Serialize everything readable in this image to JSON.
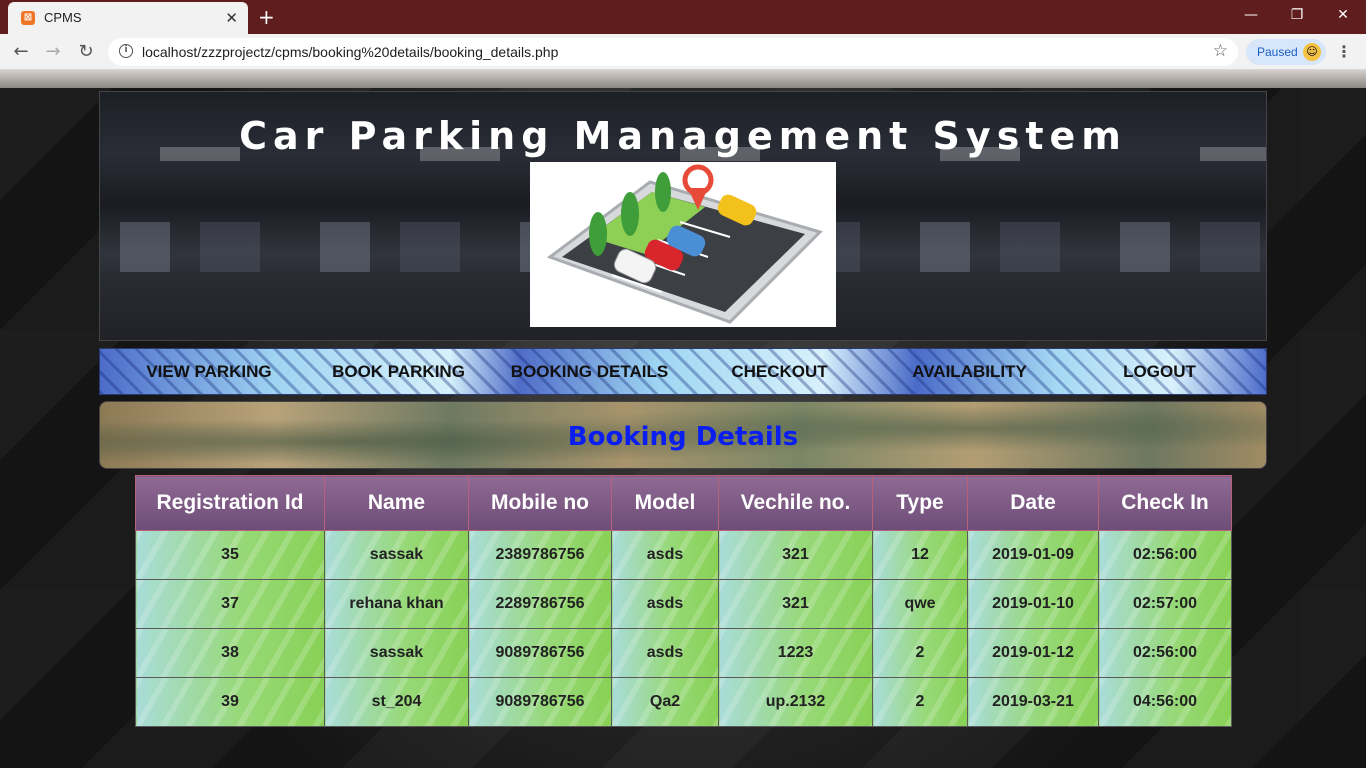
{
  "browser": {
    "tab_title": "CPMS",
    "url": "localhost/zzzprojectz/cpms/booking%20details/booking_details.php",
    "profile_status": "Paused"
  },
  "site": {
    "title": "Car Parking Management System",
    "nav": [
      {
        "label": "VIEW PARKING"
      },
      {
        "label": "BOOK PARKING"
      },
      {
        "label": "BOOKING DETAILS"
      },
      {
        "label": "CHECKOUT"
      },
      {
        "label": "AVAILABILITY"
      },
      {
        "label": "LOGOUT"
      }
    ],
    "section_title": "Booking Details"
  },
  "table": {
    "columns": [
      "Registration Id",
      "Name",
      "Mobile no",
      "Model",
      "Vechile no.",
      "Type",
      "Date",
      "Check In"
    ],
    "rows": [
      [
        "35",
        "sassak",
        "2389786756",
        "asds",
        "321",
        "12",
        "2019-01-09",
        "02:56:00"
      ],
      [
        "37",
        "rehana khan",
        "2289786756",
        "asds",
        "321",
        "qwe",
        "2019-01-10",
        "02:57:00"
      ],
      [
        "38",
        "sassak",
        "9089786756",
        "asds",
        "1223",
        "2",
        "2019-01-12",
        "02:56:00"
      ],
      [
        "39",
        "st_204",
        "9089786756",
        "Qa2",
        "up.2132",
        "2",
        "2019-03-21",
        "04:56:00"
      ]
    ]
  },
  "icons": [
    "xampp-favicon",
    "close-tab-icon",
    "new-tab-icon",
    "back-icon",
    "forward-icon",
    "reload-icon",
    "info-icon",
    "bookmark-star-icon",
    "profile-avatar-icon",
    "chrome-menu-icon",
    "minimize-icon",
    "maximize-icon",
    "window-close-icon"
  ]
}
